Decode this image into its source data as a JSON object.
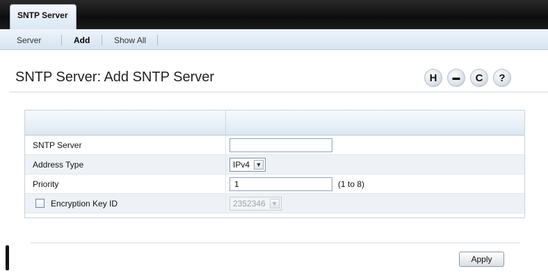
{
  "topbar": {
    "tab_label": "SNTP Server"
  },
  "subnav": {
    "items": [
      {
        "label": "Server",
        "active": false
      },
      {
        "label": "Add",
        "active": true
      },
      {
        "label": "Show All",
        "active": false
      }
    ]
  },
  "header": {
    "title": "SNTP Server: Add SNTP Server",
    "tools": [
      {
        "icon": "save-icon",
        "glyph": "H"
      },
      {
        "icon": "print-icon",
        "glyph": "▬"
      },
      {
        "icon": "refresh-icon",
        "glyph": "C"
      },
      {
        "icon": "help-icon",
        "glyph": "?"
      }
    ]
  },
  "form": {
    "rows": [
      {
        "label": "SNTP Server",
        "value": ""
      },
      {
        "label": "Address Type",
        "selected": "IPv4"
      },
      {
        "label": "Priority",
        "value": "1",
        "hint": "(1 to 8)"
      },
      {
        "label": "Encryption Key ID",
        "checked": false,
        "selected": "2352346"
      }
    ]
  },
  "actions": {
    "apply_label": "Apply"
  }
}
